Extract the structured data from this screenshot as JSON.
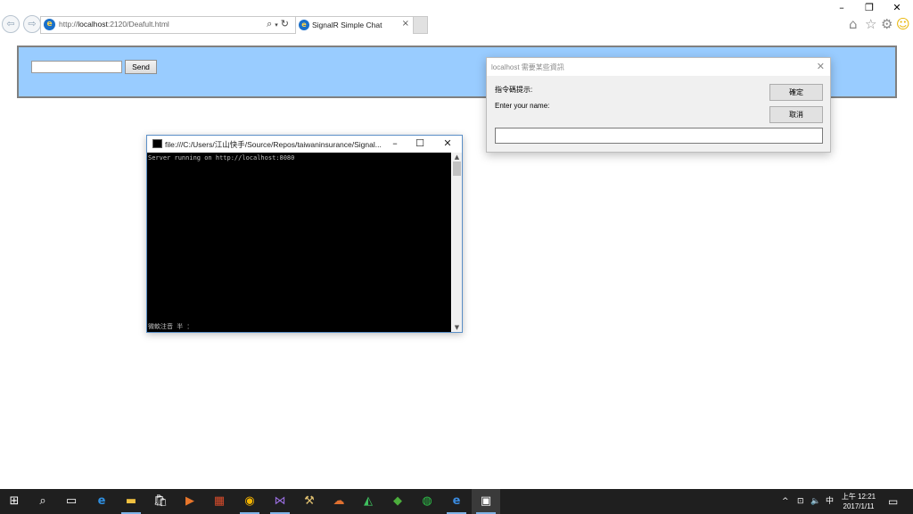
{
  "browser": {
    "url_prefix": "http://",
    "url_host": "localhost",
    "url_rest": ":2120/Deafult.html",
    "tab_title": "SignalR Simple Chat"
  },
  "page": {
    "send_label": "Send"
  },
  "console": {
    "title": "file:///C:/Users/江山快手/Source/Repos/taiwaninsurance/Signal...",
    "line1": "Server running on http://localhost:8080",
    "line2": "微軟注音 半 ："
  },
  "dialog": {
    "title": "localhost 需要某些資訊",
    "prompt_label": "指令碼提示:",
    "prompt_text": "Enter your name:",
    "ok_label": "確定",
    "cancel_label": "取消"
  },
  "taskbar": {
    "ime_label": "中",
    "time": "上午 12:21",
    "date": "2017/1/11",
    "apps": [
      "start-icon",
      "search-icon",
      "task-view-icon",
      "edge-icon",
      "file-explorer-icon",
      "store-icon",
      "media-icon",
      "office-icon",
      "chrome-icon",
      "visual-studio-icon",
      "tools-icon",
      "cloud-icon",
      "android-icon",
      "evernote-icon",
      "line-icon",
      "ie-icon",
      "console-icon"
    ]
  },
  "colors": {
    "banner": "#99ccff",
    "taskbar": "#1f1f1f",
    "console_bg": "#000000",
    "dialog_bg": "#f0f0f0"
  }
}
